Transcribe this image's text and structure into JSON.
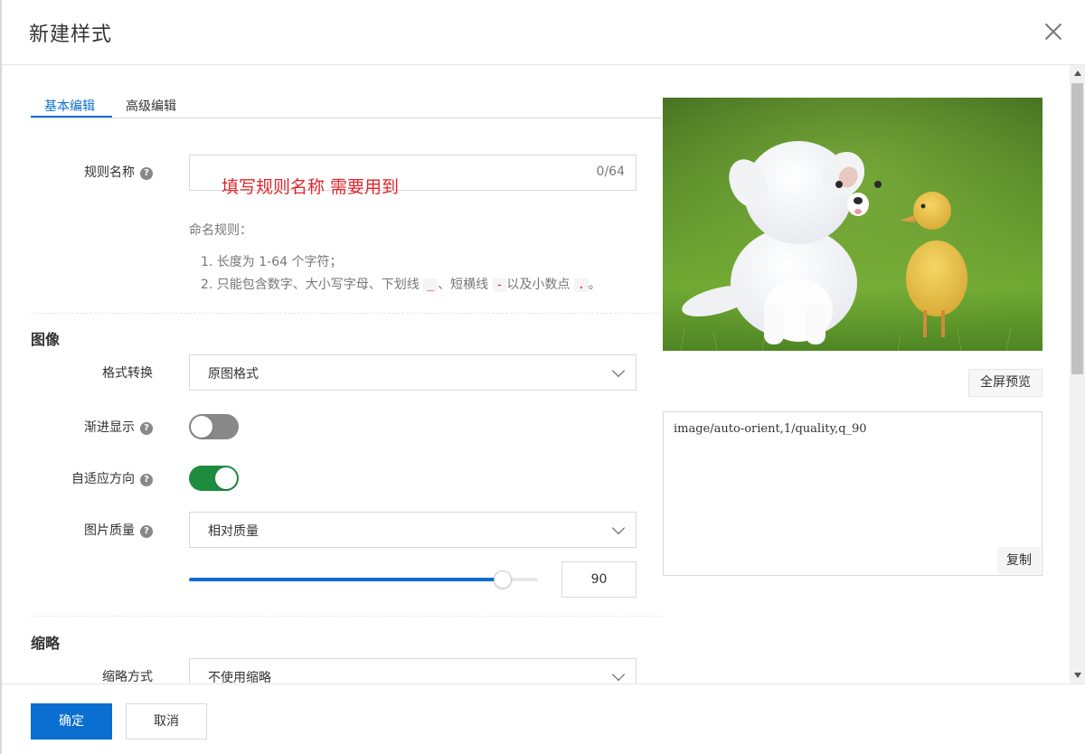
{
  "dialog": {
    "title": "新建样式"
  },
  "tabs": [
    {
      "label": "基本编辑",
      "active": true
    },
    {
      "label": "高级编辑",
      "active": false
    }
  ],
  "rule_name": {
    "label": "规则名称",
    "value": "",
    "counter": "0/64",
    "annotation": "填写规则名称 需要用到"
  },
  "naming_rules": {
    "heading": "命名规则：",
    "line1": "1. 长度为 1-64 个字符；",
    "line2_prefix": "2. 只能包含数字、大小写字母、下划线",
    "underscore": "_",
    "sep1": "、短横线",
    "dash": "-",
    "sep2": "以及小数点",
    "dot": ".",
    "end": "。"
  },
  "image_section": {
    "title": "图像",
    "format_label": "格式转换",
    "format_value": "原图格式",
    "progressive_label": "渐进显示",
    "progressive_on": false,
    "auto_orient_label": "自适应方向",
    "auto_orient_on": true,
    "quality_label": "图片质量",
    "quality_value": "相对质量",
    "quality_number": "90",
    "quality_level": 0.9
  },
  "thumbnail_section": {
    "title": "缩略",
    "mode_label": "缩略方式",
    "mode_value": "不使用缩略"
  },
  "preview": {
    "fullscreen_label": "全屏预览",
    "code": "image/auto-orient,1/quality,q_90",
    "copy_label": "复制"
  },
  "footer": {
    "ok_label": "确定",
    "cancel_label": "取消"
  },
  "colors": {
    "primary": "#0a6fd0",
    "toggle_on": "#1e8c3e",
    "toggle_off": "#888888",
    "annotation": "#e0242a"
  }
}
